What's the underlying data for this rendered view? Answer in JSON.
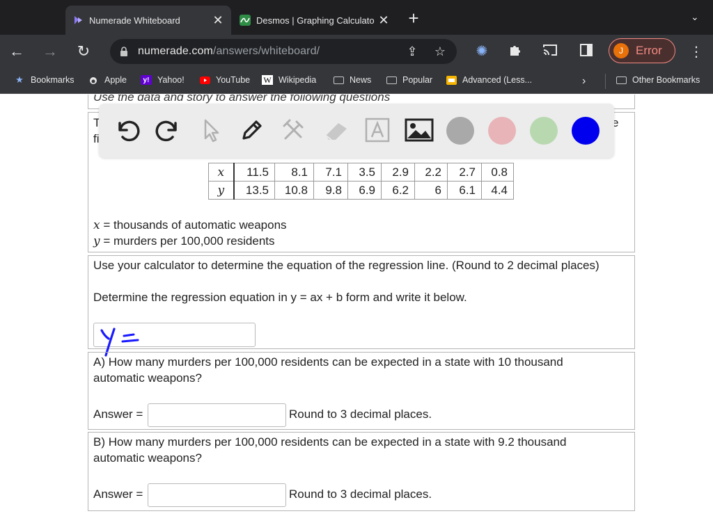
{
  "browser": {
    "tabs": [
      {
        "title": "Numerade Whiteboard",
        "active": true
      },
      {
        "title": "Desmos | Graphing Calculato",
        "active": false
      }
    ],
    "new_tab": "+",
    "url_host": "numerade.com",
    "url_path": "/answers/whiteboard/",
    "profile_initial": "J",
    "profile_label": "Error",
    "bookmarks": [
      "Bookmarks",
      "Apple",
      "Yahoo!",
      "YouTube",
      "Wikipedia",
      "News",
      "Popular",
      "Advanced (Less...",
      "Other Bookmarks"
    ]
  },
  "whiteboard": {
    "tools": [
      "undo-icon",
      "redo-icon",
      "pointer-icon",
      "pen-icon",
      "tools-icon",
      "eraser-icon",
      "text-icon",
      "image-icon"
    ],
    "colors": [
      "#a9a9a9",
      "#e8b4b8",
      "#b8d9b0",
      "#0000ee"
    ]
  },
  "problem": {
    "intro": "Use the data and story to answer the following questions",
    "intro_cut_1": "T",
    "intro_cut_2": "fi",
    "intro_cut_3": "e",
    "table": {
      "x_label": "x",
      "y_label": "y",
      "x_values": [
        "11.5",
        "8.1",
        "7.1",
        "3.5",
        "2.9",
        "2.2",
        "2.7",
        "0.8"
      ],
      "y_values": [
        "13.5",
        "10.8",
        "9.8",
        "6.9",
        "6.2",
        "6",
        "6.1",
        "4.4"
      ]
    },
    "def_x_var": "x",
    "def_x_text": " = thousands of automatic weapons",
    "def_y_var": "y",
    "def_y_text": " = murders per 100,000 residents",
    "regression_prompt": "Use your calculator to determine the equation of the regression line. (Round to 2 decimal places)",
    "regression_form": "Determine the regression equation in y = ax + b form and write it below.",
    "part_a_line1": "A) How many murders per 100,000 residents can be expected in a state with 10 thousand",
    "part_a_line2": "automatic weapons?",
    "part_b_line1": "B) How many murders per 100,000 residents can be expected in a state with 9.2 thousand",
    "part_b_line2": "automatic weapons?",
    "answer_label": "Answer =",
    "round_note": "Round to 3 decimal places."
  }
}
